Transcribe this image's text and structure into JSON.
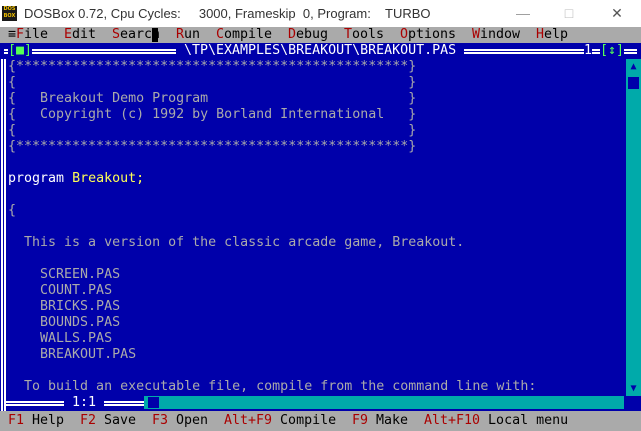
{
  "window": {
    "icon_text": "DOS BOX",
    "title": "DOSBox 0.72, Cpu Cycles:     3000, Frameskip  0, Program:    TURBO",
    "minimize_glyph": "—",
    "maximize_glyph": "□",
    "close_glyph": "✕"
  },
  "menu": {
    "system_glyph": "≡",
    "items": [
      {
        "hot": "F",
        "rest": "ile"
      },
      {
        "hot": "E",
        "rest": "dit"
      },
      {
        "hot": "S",
        "rest": "earch"
      },
      {
        "hot": "R",
        "rest": "un"
      },
      {
        "hot": "C",
        "rest": "ompile"
      },
      {
        "hot": "D",
        "rest": "ebug"
      },
      {
        "hot": "T",
        "rest": "ools"
      },
      {
        "hot": "O",
        "rest": "ptions"
      },
      {
        "hot": "W",
        "rest": "indow"
      },
      {
        "hot": "H",
        "rest": "elp"
      }
    ]
  },
  "editor": {
    "close_box": "[■]",
    "file_path": " \\TP\\EXAMPLES\\BREAKOUT\\BREAKOUT.PAS ",
    "window_number": "1",
    "zoom_box": "[↕]",
    "position": " 1:1 ",
    "code": {
      "border_top": "{*************************************************}",
      "blank_1": "{                                                 }",
      "line_title": "{   Breakout Demo Program                         }",
      "line_copyright": "{   Copyright (c) 1992 by Borland International   }",
      "blank_2": "{                                                 }",
      "border_bottom": "{*************************************************}",
      "program_keyword": "program",
      "program_name": "Breakout;",
      "open_brace": "{",
      "description": "  This is a version of the classic arcade game, Breakout.",
      "units": [
        "    SCREEN.PAS",
        "    COUNT.PAS",
        "    BRICKS.PAS",
        "    BOUNDS.PAS",
        "    WALLS.PAS",
        "    BREAKOUT.PAS"
      ],
      "build_note": "  To build an executable file, compile from the command line with:"
    }
  },
  "status": {
    "items": [
      {
        "key": "F1",
        "label": " Help"
      },
      {
        "key": "F2",
        "label": " Save"
      },
      {
        "key": "F3",
        "label": " Open"
      },
      {
        "key": "Alt+F9",
        "label": " Compile"
      },
      {
        "key": "F9",
        "label": " Make"
      },
      {
        "key": "Alt+F10",
        "label": " Local menu"
      }
    ]
  },
  "colors": {
    "dos_blue": "#0000aa",
    "menu_gray": "#aaaaaa",
    "hotkey_red": "#aa0000",
    "identifier_yellow": "#ffff55",
    "scroll_cyan": "#00aaaa",
    "frame_green": "#55ff55"
  }
}
